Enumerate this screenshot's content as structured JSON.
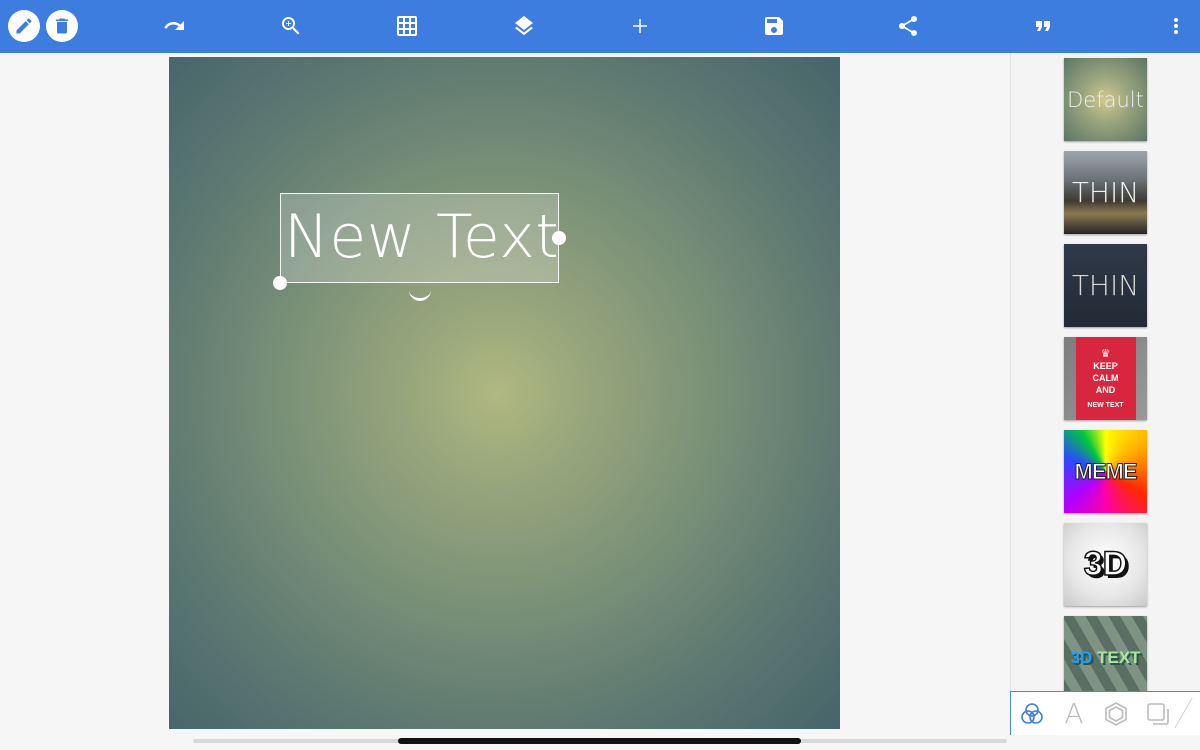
{
  "toolbar": {
    "background": "#3d7de0",
    "icons": [
      "pencil-icon",
      "trash-icon",
      "undo-icon",
      "zoom-in-icon",
      "grid-icon",
      "layers-icon",
      "add-icon",
      "save-icon",
      "share-icon",
      "quote-icon",
      "more-vert-icon"
    ]
  },
  "canvas": {
    "text_layer": "New Text"
  },
  "presets": [
    {
      "label": "Default"
    },
    {
      "label": "THIN"
    },
    {
      "label": "THIN"
    },
    {
      "label_lines": [
        "KEEP",
        "CALM",
        "AND"
      ],
      "sub": "NEW TEXT"
    },
    {
      "label": "MEME"
    },
    {
      "label": "3D"
    },
    {
      "label_a": "3D",
      "label_b": " TEXT"
    }
  ],
  "panel_tabs": [
    {
      "icon": "color-circles-icon",
      "active": true
    },
    {
      "icon": "font-icon",
      "glyph": "A",
      "active": false
    },
    {
      "icon": "stroke-hexagon-icon",
      "active": false
    },
    {
      "icon": "shadow-squares-icon",
      "active": false
    }
  ]
}
